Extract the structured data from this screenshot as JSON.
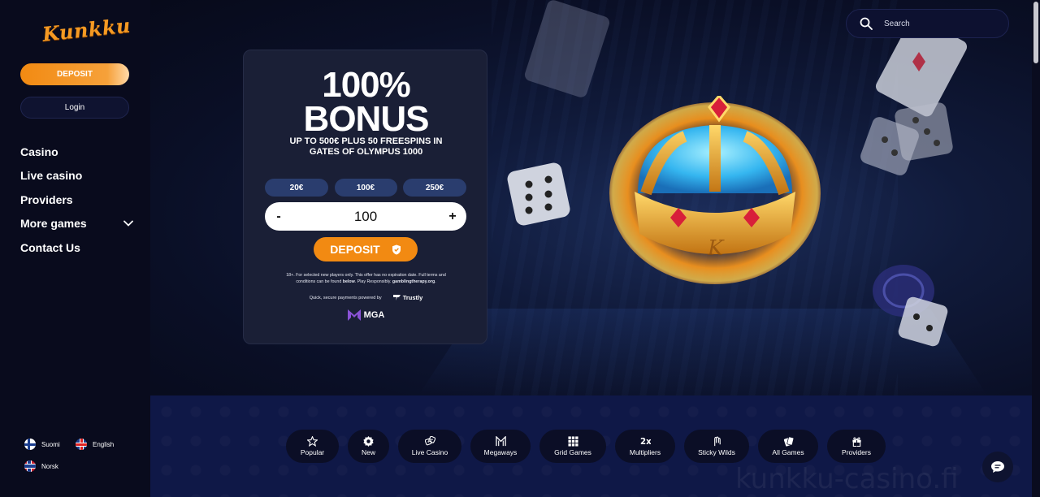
{
  "brand": {
    "logo_text": "Kunkku"
  },
  "sidebar": {
    "deposit_label": "DEPOSIT",
    "login_label": "Login",
    "nav": [
      {
        "label": "Casino"
      },
      {
        "label": "Live casino"
      },
      {
        "label": "Providers"
      },
      {
        "label": "More games",
        "icon": "chevron-down-icon"
      },
      {
        "label": "Contact Us"
      }
    ],
    "languages": [
      {
        "label": "Suomi",
        "icon": "flag-finland-icon"
      },
      {
        "label": "English",
        "icon": "flag-uk-icon"
      },
      {
        "label": "Norsk",
        "icon": "flag-norway-icon"
      }
    ]
  },
  "search": {
    "placeholder": "Search",
    "icon": "search-icon"
  },
  "promo": {
    "title_line1": "100%",
    "title_line2": "BONUS",
    "subtitle_line1": "UP TO 500€ PLUS 50 FREESPINS IN",
    "subtitle_line2": "GATES OF OLYMPUS 1000",
    "amount_options": [
      "20€",
      "100€",
      "250€"
    ],
    "stepper": {
      "minus": "-",
      "value": "100",
      "plus": "+"
    },
    "deposit_label": "DEPOSIT",
    "terms_line1": "18+. For selected new players only. This offer has no expiration date. Full terms and",
    "terms_line2_a": "conditions can be found ",
    "terms_line2_b": "below",
    "terms_line2_c": ". Play Responsibly. ",
    "terms_line2_d": "gamblingtherapy.org",
    "terms_line2_e": ".",
    "payments_text": "Quick, secure payments powered by",
    "payment_provider": "Trustly",
    "license": "MGA"
  },
  "categories": [
    {
      "label": "Popular",
      "icon": "star-icon"
    },
    {
      "label": "New",
      "icon": "badge-icon"
    },
    {
      "label": "Live Casino",
      "icon": "dice-icon"
    },
    {
      "label": "Megaways",
      "icon": "megaways-icon"
    },
    {
      "label": "Grid Games",
      "icon": "grid-icon"
    },
    {
      "label": "Multipliers",
      "icon": "multiplier-icon"
    },
    {
      "label": "Sticky Wilds",
      "icon": "wilds-icon"
    },
    {
      "label": "All Games",
      "icon": "cards-icon"
    },
    {
      "label": "Providers",
      "icon": "gift-icon"
    }
  ],
  "watermark": "kunkku-casino.fi",
  "colors": {
    "accent": "#f28a12",
    "background": "#0b0d22",
    "card": "#1a1f36",
    "category_bar": "#0f1847"
  }
}
